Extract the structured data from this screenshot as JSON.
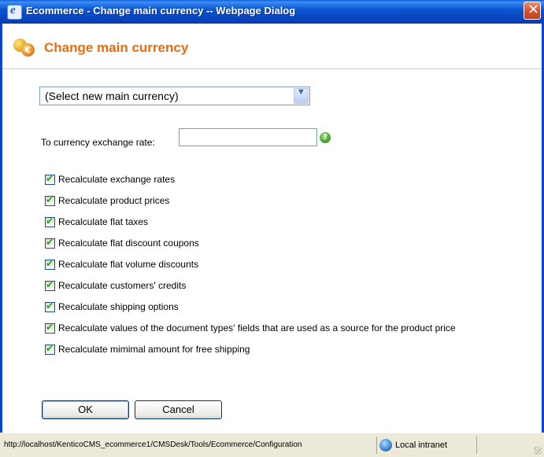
{
  "window": {
    "title": "Ecommerce - Change main currency -- Webpage Dialog",
    "app_icon": "ie-icon",
    "close_glyph": "✕"
  },
  "header": {
    "title": "Change main currency",
    "icon": "coins-icon"
  },
  "form": {
    "currency_select": {
      "value": "(Select new main currency)",
      "arrow": "▼"
    },
    "rate": {
      "label": "To currency exchange rate:",
      "value": "",
      "help": "?"
    },
    "checkboxes": [
      {
        "label": "Recalculate exchange rates",
        "checked": true
      },
      {
        "label": "Recalculate product prices",
        "checked": true
      },
      {
        "label": "Recalculate flat taxes",
        "checked": true
      },
      {
        "label": "Recalculate flat discount coupons",
        "checked": true
      },
      {
        "label": "Recalculate flat volume discounts",
        "checked": true
      },
      {
        "label": "Recalculate customers' credits",
        "checked": true
      },
      {
        "label": "Recalculate shipping options",
        "checked": true
      },
      {
        "label": "Recalculate values of the document types' fields that are used as a source for the product price",
        "checked": true
      },
      {
        "label": "Recalculate mimimal amount for free shipping",
        "checked": true
      }
    ],
    "check_glyph": "✔",
    "ok_label": "OK",
    "cancel_label": "Cancel"
  },
  "statusbar": {
    "url": "http://localhost/KenticoCMS_ecommerce1/CMSDesk/Tools/Ecommerce/Configuration",
    "zone": "Local intranet"
  },
  "colors": {
    "title_accent": "#e86b0c",
    "titlebar": "#0a55d0",
    "check": "#21a121"
  }
}
